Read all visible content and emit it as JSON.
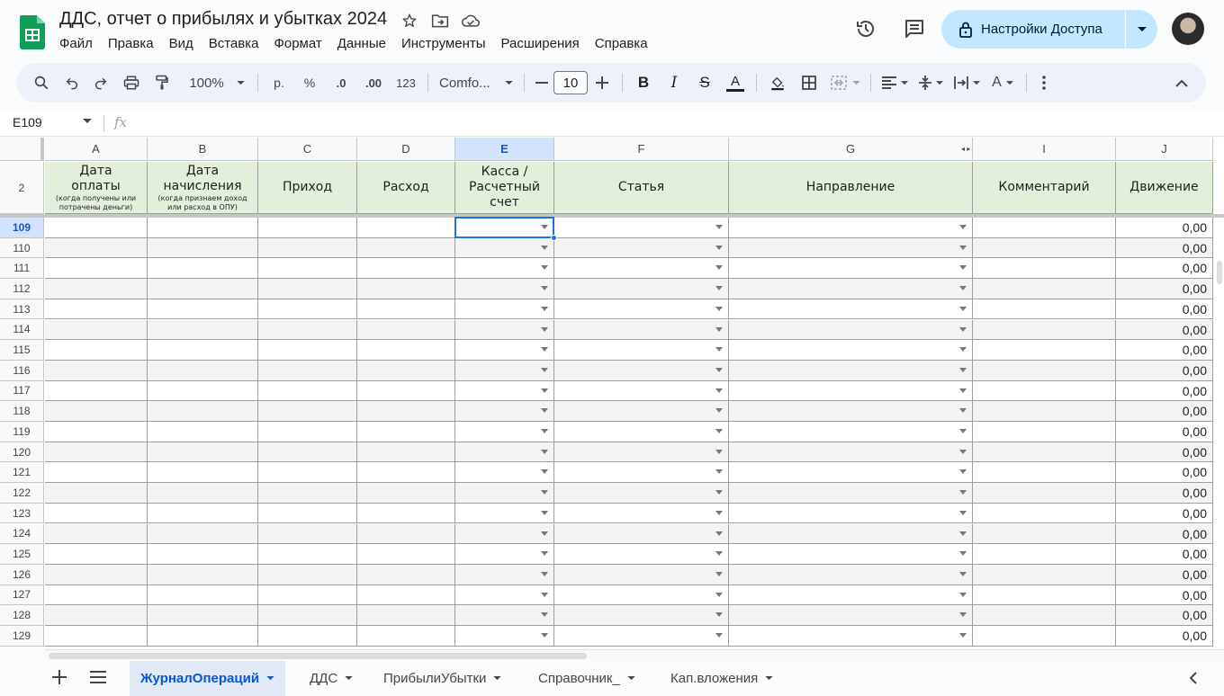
{
  "doc": {
    "title": "ДДС, отчет о прибылях и убытках 2024"
  },
  "menu": [
    "Файл",
    "Правка",
    "Вид",
    "Вставка",
    "Формат",
    "Данные",
    "Инструменты",
    "Расширения",
    "Справка"
  ],
  "share": {
    "label": "Настройки Доступа"
  },
  "toolbar": {
    "zoom": "100%",
    "currency": "р.",
    "percent": "%",
    "dec_less": ".0",
    "dec_more": ".00",
    "number_format": "123",
    "font": "Comfo...",
    "font_size": "10"
  },
  "formula": {
    "cell_ref": "E109",
    "fx": "fx",
    "value": ""
  },
  "columns": [
    "A",
    "B",
    "C",
    "D",
    "E",
    "F",
    "G",
    "I",
    "J"
  ],
  "header_row_number": "2",
  "headers": {
    "a_title": "Дата оплаты",
    "a_sub": "(когда получены или потрачены деньги)",
    "b_title": "Дата начисления",
    "b_sub": "(когда признаем доход или расход в ОПУ)",
    "c": "Приход",
    "d": "Расход",
    "e": "Касса / Расчетный счет",
    "f": "Статья",
    "g": "Направление",
    "i": "Комментарий",
    "j": "Движение"
  },
  "selected": {
    "column": "E",
    "row": "109"
  },
  "rows": [
    {
      "n": "109",
      "movement": "0,00"
    },
    {
      "n": "110",
      "movement": "0,00"
    },
    {
      "n": "111",
      "movement": "0,00"
    },
    {
      "n": "112",
      "movement": "0,00"
    },
    {
      "n": "113",
      "movement": "0,00"
    },
    {
      "n": "114",
      "movement": "0,00"
    },
    {
      "n": "115",
      "movement": "0,00"
    },
    {
      "n": "116",
      "movement": "0,00"
    },
    {
      "n": "117",
      "movement": "0,00"
    },
    {
      "n": "118",
      "movement": "0,00"
    },
    {
      "n": "119",
      "movement": "0,00"
    },
    {
      "n": "120",
      "movement": "0,00"
    },
    {
      "n": "121",
      "movement": "0,00"
    },
    {
      "n": "122",
      "movement": "0,00"
    },
    {
      "n": "123",
      "movement": "0,00"
    },
    {
      "n": "124",
      "movement": "0,00"
    },
    {
      "n": "125",
      "movement": "0,00"
    },
    {
      "n": "126",
      "movement": "0,00"
    },
    {
      "n": "127",
      "movement": "0,00"
    },
    {
      "n": "128",
      "movement": "0,00"
    },
    {
      "n": "129",
      "movement": "0,00"
    }
  ],
  "sheets": [
    {
      "label": "ЖурналОпераций",
      "active": true
    },
    {
      "label": "ДДС",
      "active": false
    },
    {
      "label": "ПрибылиУбытки",
      "active": false
    },
    {
      "label": "Справочник_",
      "active": false
    },
    {
      "label": "Кап.вложения",
      "active": false
    }
  ],
  "colors": {
    "header_fill": "#e2efda",
    "selection": "#1a73e8",
    "share_button": "#c2e7ff",
    "active_tab_text": "#0b57d0",
    "logo": "#0f9d58"
  },
  "icons": [
    "sheets-logo",
    "star-icon",
    "move-folder-icon",
    "cloud-status-icon",
    "history-icon",
    "comment-icon",
    "lock-icon",
    "chevron-down-icon",
    "search-icon",
    "undo-icon",
    "redo-icon",
    "print-icon",
    "paint-format-icon",
    "minus-icon",
    "plus-icon",
    "bold-icon",
    "italic-icon",
    "strikethrough-icon",
    "text-color-icon",
    "fill-color-icon",
    "borders-icon",
    "merge-icon",
    "align-left-icon",
    "vertical-align-icon",
    "text-wrap-icon",
    "text-rotation-icon",
    "more-vert-icon",
    "chevron-up-icon",
    "add-sheet-icon",
    "all-sheets-icon",
    "chevron-left-icon"
  ]
}
